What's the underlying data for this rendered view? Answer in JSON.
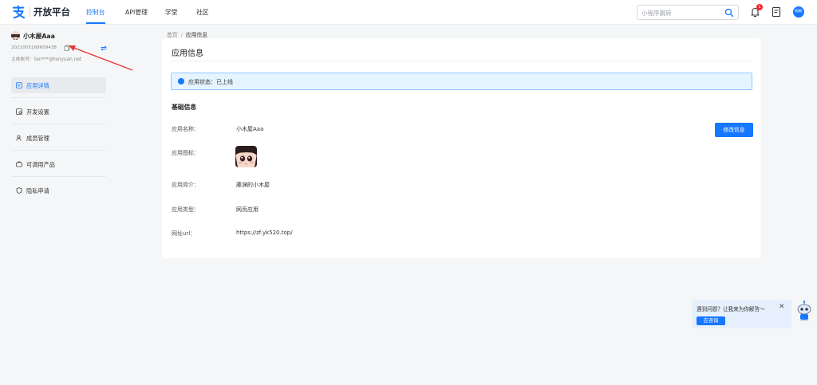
{
  "brand": {
    "name": "开放平台",
    "color": "#1677ff"
  },
  "nav": {
    "items": [
      {
        "label": "控制台",
        "active": true
      },
      {
        "label": "API管理",
        "active": false
      },
      {
        "label": "学堂",
        "active": false
      },
      {
        "label": "社区",
        "active": false
      }
    ],
    "search_placeholder": "小程序跳转",
    "notification_count": "1",
    "user_avatar_label": "蚂蚁"
  },
  "sidebar": {
    "app_name": "小木屋Aaa",
    "app_id": "2021005168609438",
    "owner": "主体账号：ten***@tenyuan.net",
    "items": [
      {
        "label": "应用详情",
        "icon": "app-detail-icon",
        "active": true
      },
      {
        "label": "开发设置",
        "icon": "dev-settings-icon",
        "active": false
      },
      {
        "label": "成员管理",
        "icon": "members-icon",
        "active": false
      },
      {
        "label": "可调用产品",
        "icon": "products-icon",
        "active": false
      },
      {
        "label": "隐私申请",
        "icon": "privacy-icon",
        "active": false
      }
    ]
  },
  "breadcrumb": {
    "home": "首页",
    "separator": "/",
    "current": "应用信息"
  },
  "main": {
    "title": "应用信息",
    "status_text": "应用状态：已上线",
    "section_title": "基础信息",
    "edit_button": "修改信息",
    "fields": [
      {
        "label": "应用名称：",
        "value": "小木屋Aaa"
      },
      {
        "label": "应用图标：",
        "value": ""
      },
      {
        "label": "应用简介：",
        "value": "藤渊的小木屋"
      },
      {
        "label": "应用类型：",
        "value": "网页应用"
      },
      {
        "label": "网址url：",
        "value": "https://zf.yk520.top/"
      }
    ]
  },
  "help": {
    "text": "遇到问题？让我来为你解答～",
    "button": "去咨询",
    "close": "✕"
  }
}
